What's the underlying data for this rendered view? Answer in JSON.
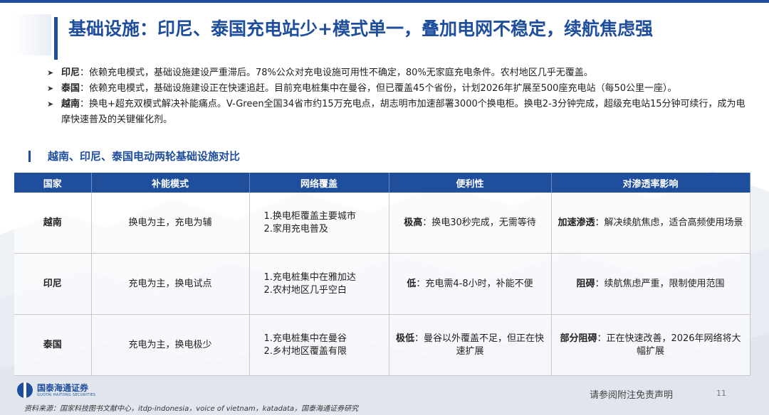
{
  "title": "基础设施：印尼、泰国充电站少+模式单一，叠加电网不稳定，续航焦虑强",
  "bullets": [
    {
      "label": "印尼",
      "text": "：依赖充电模式，基础设施建设严重滞后。78%公众对充电设施可用性不确定，80%无家庭充电条件。农村地区几乎无覆盖。"
    },
    {
      "label": "泰国",
      "text": "：依赖充电模式，基础设施建设正在快速追赶。目前充电桩集中在曼谷，但已覆盖45个省份，计划2026年扩展至500座充电站（每50公里一座）。"
    },
    {
      "label": "越南",
      "text": "：换电+超充双模式解决补能痛点。V-Green全国34省市约15万充电点，胡志明市加速部署3000个换电柜。换电2-3分钟完成，超级充电站15分钟可续行，成为电摩快速普及的关键催化剂。"
    }
  ],
  "bullet_marker": "➤",
  "section_title": "越南、印尼、泰国电动两轮基础设施对比",
  "table": {
    "headers": [
      "国家",
      "补能模式",
      "网络覆盖",
      "便利性",
      "对渗透率影响"
    ],
    "rows": [
      {
        "country": "越南",
        "mode": "换电为主，充电为辅",
        "coverage": [
          "1.换电柜覆盖主要城市",
          "2.家用充电普及"
        ],
        "conv_label": "极高",
        "conv_text": "：换电30秒完成，无需等待",
        "impact_label": "加速渗透",
        "impact_text": "：解决续航焦虑，适合高频使用场景"
      },
      {
        "country": "印尼",
        "mode": "充电为主，换电试点",
        "coverage": [
          "1.充电桩集中在雅加达",
          "2.农村地区几乎空白"
        ],
        "conv_label": "低",
        "conv_text": "：充电需4-8小时，补能不便",
        "impact_label": "阻碍",
        "impact_text": "：续航焦虑严重，限制使用范围"
      },
      {
        "country": "泰国",
        "mode": "充电为主，换电极少",
        "coverage": [
          "1.充电桩集中在曼谷",
          "2.乡村地区覆盖有限"
        ],
        "conv_label": "极低",
        "conv_text": "：曼谷以外覆盖不足，但正在快速扩展",
        "impact_label": "部分阻碍",
        "impact_text": "：正在快速改善，2026年网络将大幅扩展"
      }
    ]
  },
  "logo": {
    "cn": "国泰海通证券",
    "en": "GUOTAI HAITONG SECURITIES"
  },
  "disclaimer": "请参阅附注免责声明",
  "page_number": "11",
  "source": "资料来源：国家科技图书文献中心，itdp-indonesia，voice of vietnam，katadata，国泰海通证券研究",
  "colors": {
    "brand": "#1f4e9c",
    "header_text": "#ffffff"
  }
}
